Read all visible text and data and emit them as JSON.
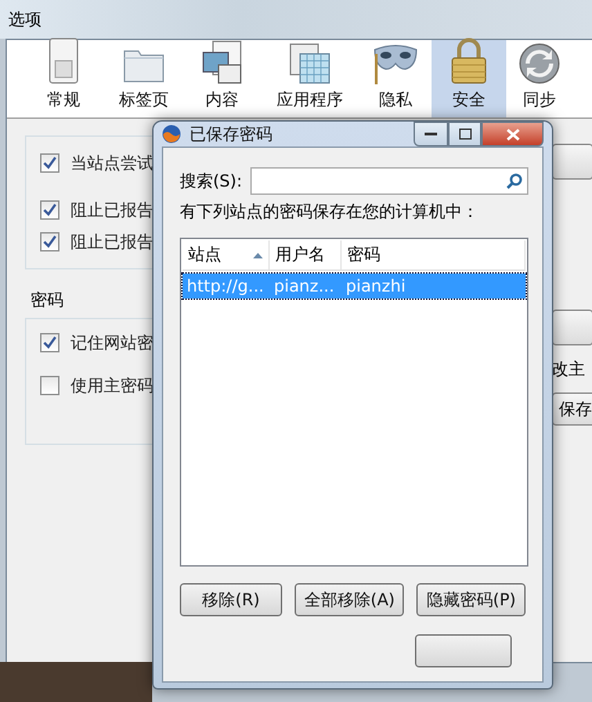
{
  "window": {
    "title": "选项"
  },
  "toolbar": [
    {
      "label": "常规",
      "selected": false
    },
    {
      "label": "标签页",
      "selected": false
    },
    {
      "label": "内容",
      "selected": false
    },
    {
      "label": "应用程序",
      "selected": false
    },
    {
      "label": "隐私",
      "selected": false
    },
    {
      "label": "安全",
      "selected": true
    },
    {
      "label": "同步",
      "selected": false
    }
  ],
  "security_group": {
    "checkboxes": [
      {
        "label": "当站点尝试",
        "checked": true
      },
      {
        "label": "阻止已报告",
        "checked": true
      },
      {
        "label": "阻止已报告",
        "checked": true
      }
    ]
  },
  "password_group": {
    "title": "密码",
    "checkboxes": [
      {
        "label": "记住网站密",
        "checked": true
      },
      {
        "label": "使用主密码",
        "checked": false
      }
    ]
  },
  "right_side": {
    "label": "改主",
    "button": "保存"
  },
  "dialog": {
    "title": "已保存密码",
    "search_label": "搜索(S):",
    "description": "有下列站点的密码保存在您的计算机中：",
    "columns": [
      {
        "label": "站点",
        "sorted": true
      },
      {
        "label": "用户名",
        "sorted": false
      },
      {
        "label": "密码",
        "sorted": false
      }
    ],
    "rows": [
      {
        "cells": [
          "http://g...",
          "pianz...",
          "pianzhi"
        ],
        "selected": true
      }
    ],
    "buttons": [
      "移除(R)",
      "全部移除(A)",
      "隐藏密码(P)"
    ]
  }
}
